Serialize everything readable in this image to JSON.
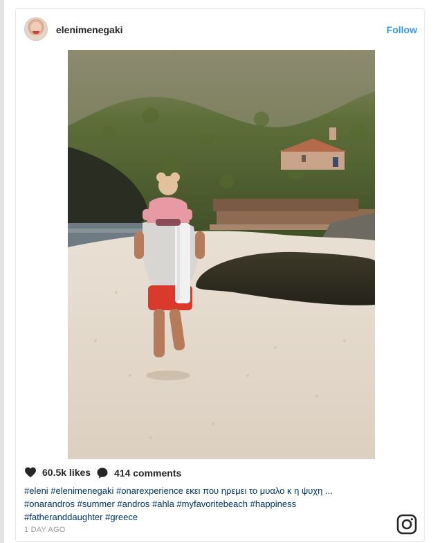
{
  "post": {
    "username": "elenimenegaki",
    "follow_label": "Follow",
    "likes": "60.5k likes",
    "comments": "414 comments",
    "caption_line1": "#eleni #elenimenegaki #onarexperience εκει που ηρεμει το μυαλο κ η ψυχη ...",
    "caption_line2": "#onarandros #summer #andros #ahla #myfavoritebeach #happiness",
    "caption_line3": "#fatheranddaughter #greece",
    "timestamp": "1 DAY AGO"
  },
  "icons": {
    "heart": "heart-icon",
    "comment": "comment-bubble-icon",
    "instagram": "instagram-logo-icon"
  },
  "colors": {
    "link_blue": "#3897f0",
    "hashtag": "#003569",
    "text": "#262626",
    "muted": "#999999"
  }
}
